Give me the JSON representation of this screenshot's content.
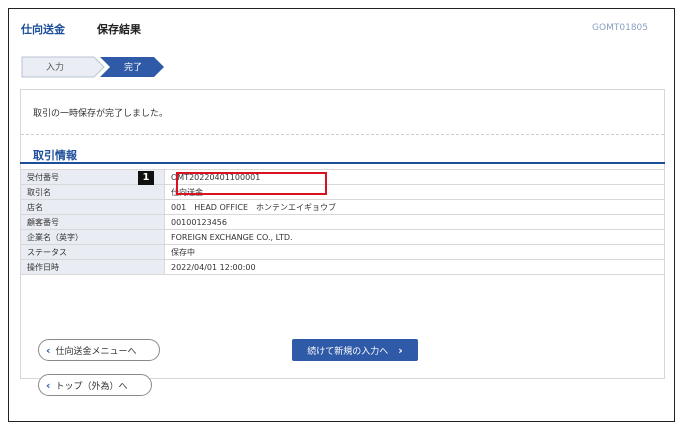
{
  "header": {
    "breadcrumb": "仕向送金",
    "title": "保存結果",
    "screen_code": "GOMT01805"
  },
  "steps": [
    {
      "label": "入力",
      "state": "previous"
    },
    {
      "label": "完了",
      "state": "current"
    }
  ],
  "message": "取引の一時保存が完了しました。",
  "section_title": "取引情報",
  "marker_number": "1",
  "info_rows": [
    {
      "key": "受付番号",
      "value": "OMT20220401100001"
    },
    {
      "key": "取引名",
      "value": "仕向送金"
    },
    {
      "key": "店名",
      "value": "001　HEAD OFFICE　ホンテンエイギョウブ"
    },
    {
      "key": "顧客番号",
      "value": "00100123456"
    },
    {
      "key": "企業名（英字）",
      "value": "FOREIGN EXCHANGE CO., LTD."
    },
    {
      "key": "ステータス",
      "value": "保存中"
    },
    {
      "key": "操作日時",
      "value": "2022/04/01 12:00:00"
    }
  ],
  "buttons": {
    "back_menu": "仕向送金メニューへ",
    "continue_new": "続けて新規の入力へ",
    "top": "トップ（外為）へ"
  },
  "colors": {
    "accent": "#1d4e9a",
    "button_primary": "#2f5aa8",
    "highlight": "#d9121f",
    "step_current": "#2f5aa8",
    "step_previous": "#eaeef4"
  },
  "icons": {
    "back": "chevron-left-icon",
    "forward": "chevron-right-icon"
  }
}
